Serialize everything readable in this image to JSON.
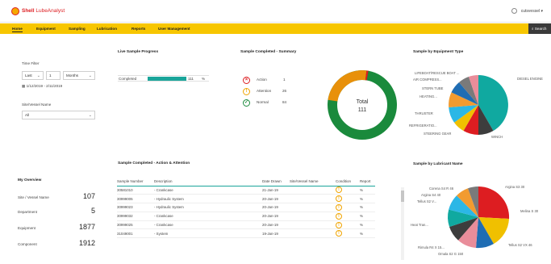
{
  "app": {
    "brand_a": "Shell ",
    "brand_b": "LubeAnalyst",
    "user": "cutsvessel"
  },
  "nav": {
    "items": [
      "Home",
      "Equipment",
      "Sampling",
      "Lubrication",
      "Reports",
      "User Management"
    ],
    "search": "Search"
  },
  "filters": {
    "time_filter_label": "Time Filter",
    "relative": "Last",
    "count": "1",
    "unit": "Months",
    "date_range": "1/12/2019 - 2/11/2019",
    "site_label": "Site/Vessel Name",
    "site_value": "All"
  },
  "overview": {
    "title": "My Overview",
    "rows": [
      {
        "label": "Site / Vessel Name",
        "value": "107"
      },
      {
        "label": "Department",
        "value": "5"
      },
      {
        "label": "Equipment",
        "value": "1877"
      },
      {
        "label": "Component",
        "value": "1912"
      }
    ]
  },
  "live_progress": {
    "title": "Live Sample Progress",
    "label": "Completed",
    "value": "111",
    "unit": "%",
    "fill_fraction": 0.66
  },
  "summary": {
    "title": "Sample Completed - Summary",
    "legend": [
      {
        "label": "Action",
        "value": "1",
        "icon": "x-circle-icon",
        "color": "#dd1d21"
      },
      {
        "label": "Attention",
        "value": "26",
        "icon": "exclamation-circle-icon",
        "color": "#f0a400"
      },
      {
        "label": "Normal",
        "value": "84",
        "icon": "check-circle-icon",
        "color": "#1a8a3c"
      }
    ],
    "donut_label": "Total",
    "donut_value": "111"
  },
  "equipment_pie": {
    "title": "Sample by Equipment Type",
    "labels": [
      "LIFEBOAT/RESCUE BOAT ...",
      "AIR COMPRESS...",
      "STERN TUBE",
      "HEATING...",
      "THRUSTER",
      "REFRIGERATIO...",
      "STEERING GEAR",
      "WINCH",
      "DIESEL ENGINE"
    ]
  },
  "lubricant_pie": {
    "title": "Sample by Lubricant Name",
    "labels": [
      "Corena S4 R 46",
      "Argina S4 40",
      "Tellus S2 V...",
      "Heat Tran...",
      "Rimula R4 X 15...",
      "Omala S2 G 150",
      "Tellus S2 VX 46",
      "Melina S 30",
      "Argina S3 30"
    ]
  },
  "table": {
    "title": "Sample Completed - Action & Attention",
    "columns": [
      "Sample Number",
      "Description",
      "Date Drawn",
      "Site/Vessel Name",
      "Condition",
      "Report"
    ],
    "rows": [
      {
        "num": "30581010",
        "desc": "- Crankcase",
        "date": "21-Jan-19",
        "site": "",
        "report": "%"
      },
      {
        "num": "30999005",
        "desc": "- Hydraulic System",
        "date": "20-Jan-19",
        "site": "",
        "report": "%"
      },
      {
        "num": "30999023",
        "desc": "- Hydraulic System",
        "date": "20-Jan-19",
        "site": "",
        "report": "%"
      },
      {
        "num": "30999032",
        "desc": "- Crankcase",
        "date": "20-Jan-19",
        "site": "",
        "report": "%"
      },
      {
        "num": "30999025",
        "desc": "- Crankcase",
        "date": "20-Jan-19",
        "site": "",
        "report": "%"
      },
      {
        "num": "31049001",
        "desc": "- System",
        "date": "19-Jan-19",
        "site": "",
        "report": "%"
      }
    ]
  },
  "colors": {
    "nav": "#f7c600",
    "teal": "#1aa59a",
    "green": "#1a8a3c",
    "orange": "#e8900a",
    "red": "#dd1d21"
  }
}
